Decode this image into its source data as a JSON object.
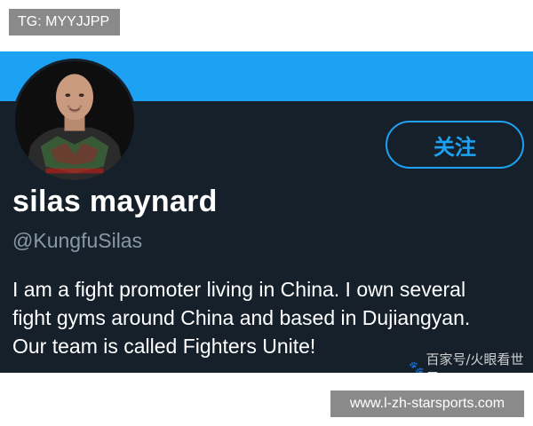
{
  "top_label": "TG: MYYJJPP",
  "profile": {
    "follow_label": "关注",
    "display_name": "silas maynard",
    "handle": "@KungfuSilas",
    "bio_lines": [
      "I am a fight promoter living in China.  I own several",
      "fight gyms around China and based in Dujiangyan.",
      "Our team is called Fighters Unite!"
    ]
  },
  "watermark": "百家号/火眼看世界",
  "bottom_label": "www.l-zh-starsports.com",
  "colors": {
    "card_bg": "#15202b",
    "banner": "#1da1f2",
    "accent": "#1da1f2",
    "handle": "#8899a6"
  },
  "icons": {
    "avatar": "profile-photo-avatar",
    "watermark": "paw-icon"
  }
}
